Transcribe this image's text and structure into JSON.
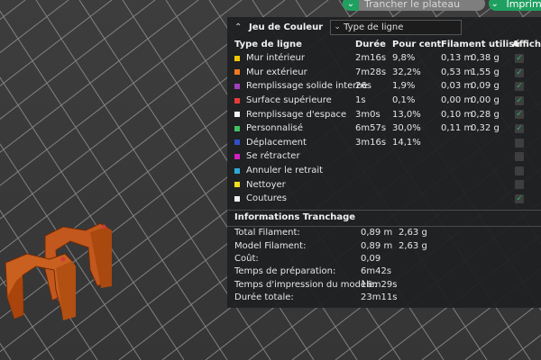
{
  "toolbar": {
    "slice_label": "Trancher le plateau",
    "print_label": "Imprimer"
  },
  "panel": {
    "title": "Jeu de Couleur",
    "select_value": "Type de ligne",
    "headers": {
      "type": "Type de ligne",
      "duration": "Durée",
      "percent": "Pour cent",
      "filament": "Filament utilisé",
      "show": "Afficher"
    },
    "rows": [
      {
        "label": "Mur intérieur",
        "color": "#f0c800",
        "duration": "2m16s",
        "percent": "9,8%",
        "fil_m": "0,13 m",
        "fil_g": "0,38 g",
        "checked": true
      },
      {
        "label": "Mur extérieur",
        "color": "#f07820",
        "duration": "7m28s",
        "percent": "32,2%",
        "fil_m": "0,53 m",
        "fil_g": "1,55 g",
        "checked": true
      },
      {
        "label": "Remplissage solide interne",
        "color": "#a040c0",
        "duration": "26s",
        "percent": "1,9%",
        "fil_m": "0,03 m",
        "fil_g": "0,09 g",
        "checked": true
      },
      {
        "label": "Surface supérieure",
        "color": "#e83c3c",
        "duration": "1s",
        "percent": "0,1%",
        "fil_m": "0,00 m",
        "fil_g": "0,00 g",
        "checked": true
      },
      {
        "label": "Remplissage d'espace",
        "color": "#f4f4f4",
        "duration": "3m0s",
        "percent": "13,0%",
        "fil_m": "0,10 m",
        "fil_g": "0,28 g",
        "checked": true
      },
      {
        "label": "Personnalisé",
        "color": "#40c060",
        "duration": "6m57s",
        "percent": "30,0%",
        "fil_m": "0,11 m",
        "fil_g": "0,32 g",
        "checked": true
      },
      {
        "label": "Déplacement",
        "color": "#3050c8",
        "duration": "3m16s",
        "percent": "14,1%",
        "fil_m": "",
        "fil_g": "",
        "checked": false
      },
      {
        "label": "Se rétracter",
        "color": "#d020c0",
        "duration": "",
        "percent": "",
        "fil_m": "",
        "fil_g": "",
        "checked": false
      },
      {
        "label": "Annuler le retrait",
        "color": "#30a8d8",
        "duration": "",
        "percent": "",
        "fil_m": "",
        "fil_g": "",
        "checked": false
      },
      {
        "label": "Nettoyer",
        "color": "#f0e020",
        "duration": "",
        "percent": "",
        "fil_m": "",
        "fil_g": "",
        "checked": false
      },
      {
        "label": "Coutures",
        "color": "#f0f0f0",
        "duration": "",
        "percent": "",
        "fil_m": "",
        "fil_g": "",
        "checked": true
      }
    ]
  },
  "info": {
    "title": "Informations Tranchage",
    "rows": [
      {
        "label": "Total Filament:",
        "v1": "0,89 m",
        "v2": "2,63 g"
      },
      {
        "label": "Model Filament:",
        "v1": "0,89 m",
        "v2": "2,63 g"
      },
      {
        "label": "Coût:",
        "v1": "0,09",
        "v2": ""
      },
      {
        "label": "Temps de préparation:",
        "v1": "6m42s",
        "v2": ""
      },
      {
        "label": "Temps d'impression du modèle:",
        "v1": "16m29s",
        "v2": ""
      },
      {
        "label": "Durée totale:",
        "v1": "23m11s",
        "v2": ""
      }
    ]
  }
}
